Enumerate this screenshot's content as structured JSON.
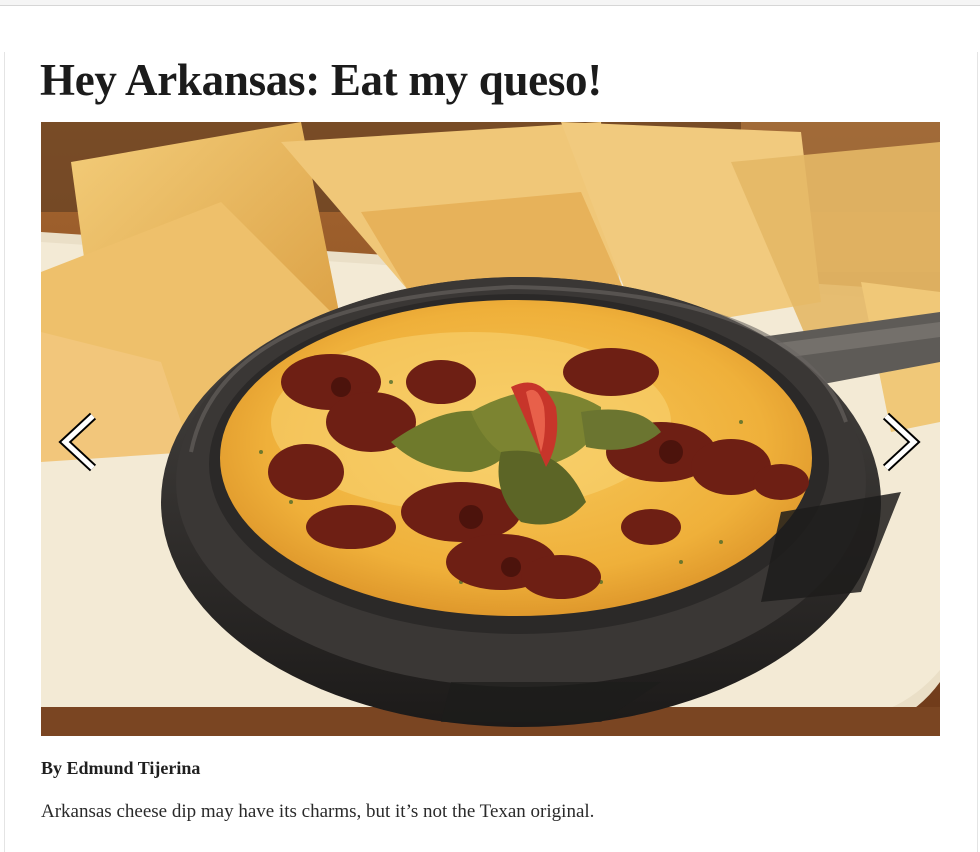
{
  "article": {
    "headline": "Hey Arkansas: Eat my queso!",
    "byline": "By Edmund Tijerina",
    "dek": "Arkansas cheese dip may have its charms, but it’s not the Texan original."
  },
  "gallery": {
    "photo_subject": "queso-in-cast-iron-skillet-with-tortilla-chips",
    "prev_icon": "chevron-left-icon",
    "next_icon": "chevron-right-icon"
  },
  "colors": {
    "headline": "#1b1b1b",
    "text": "#2a2a2a",
    "queso": "#f0b43a",
    "chips": "#e9b85c",
    "skillet": "#2a2826",
    "chorizo": "#6e1f14",
    "table": "#8a5028"
  }
}
